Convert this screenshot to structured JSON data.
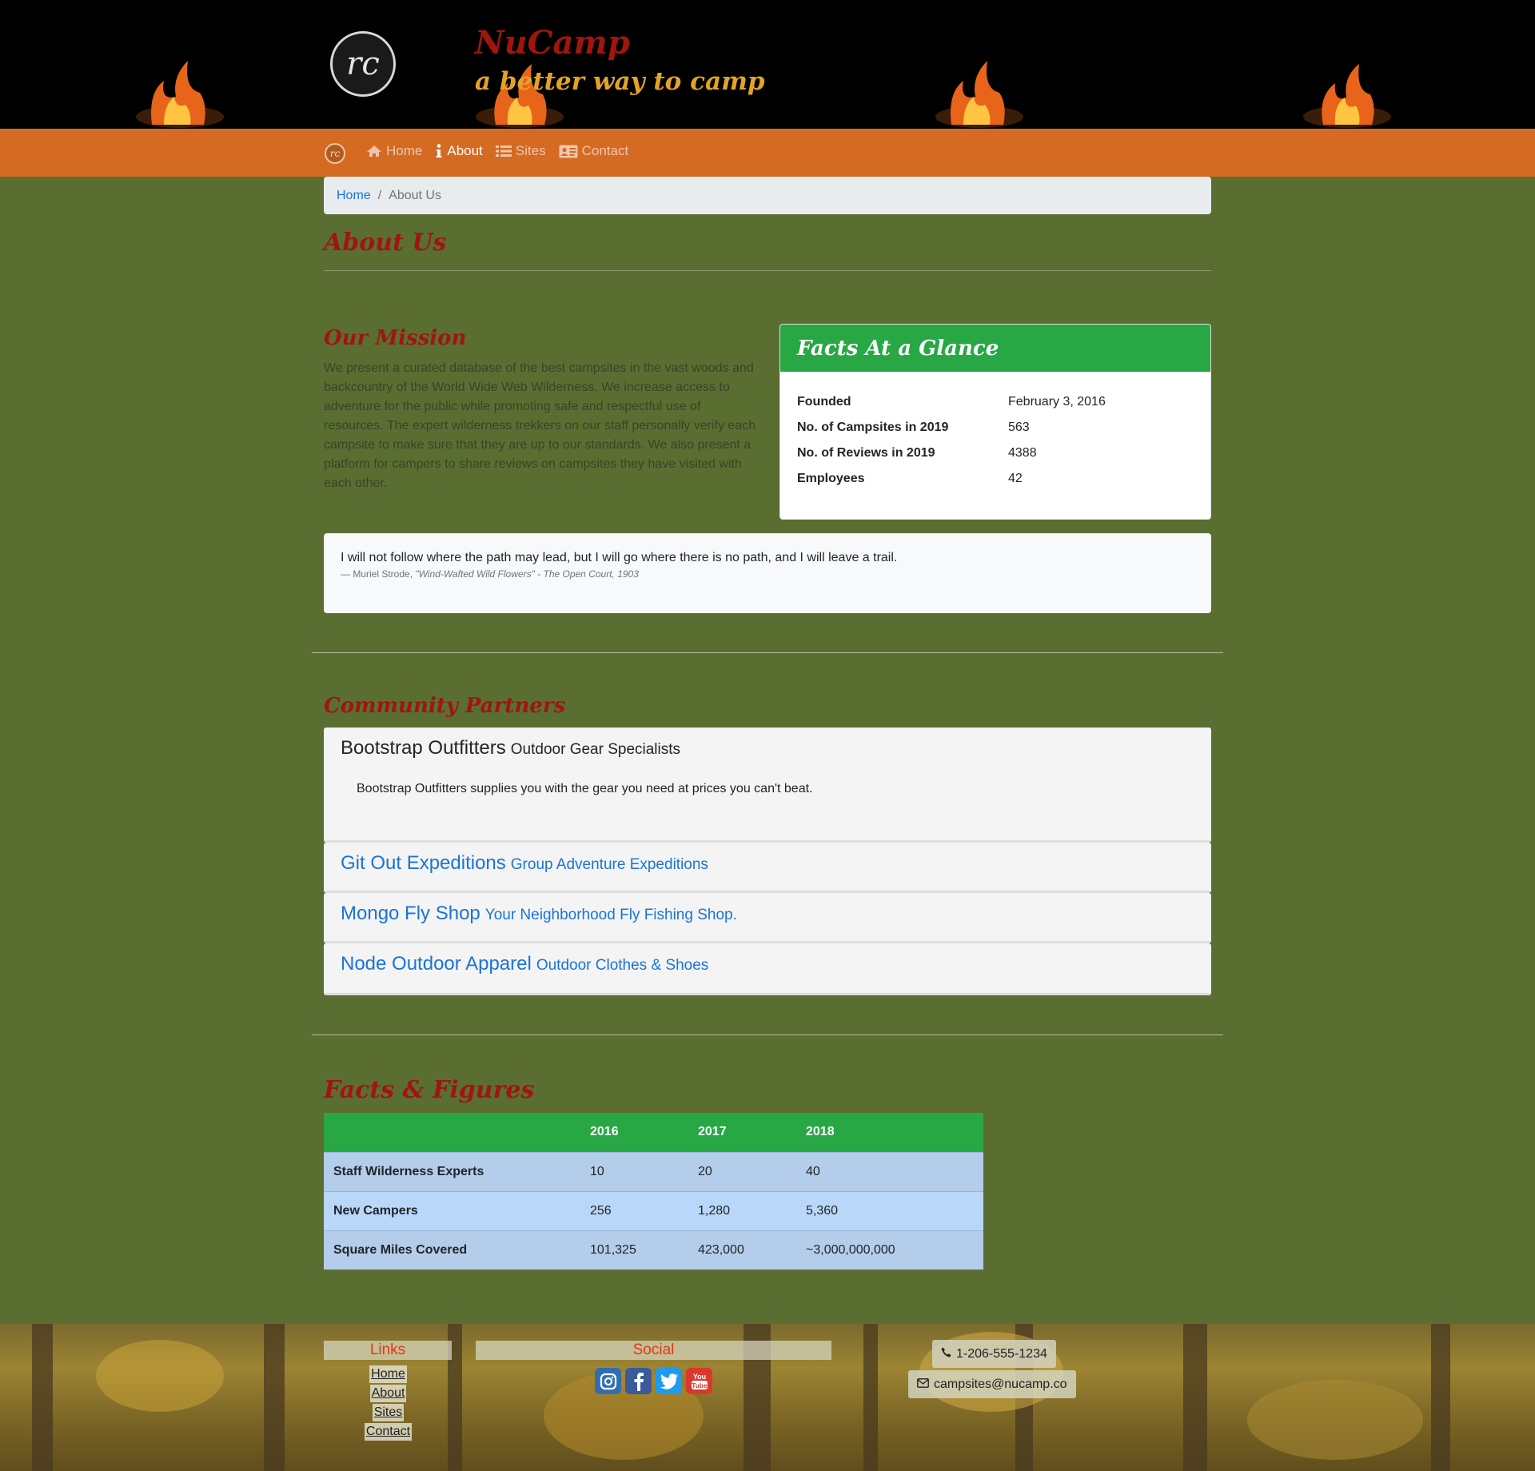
{
  "brand": {
    "title": "NuCamp",
    "tagline": "a better way to camp",
    "logo_glyph": "rc"
  },
  "nav": {
    "items": [
      {
        "label": "Home",
        "icon": "home-icon"
      },
      {
        "label": "About",
        "icon": "info-icon",
        "active": true
      },
      {
        "label": "Sites",
        "icon": "list-icon"
      },
      {
        "label": "Contact",
        "icon": "address-card-icon"
      }
    ]
  },
  "breadcrumb": {
    "home": "Home",
    "separator": "/",
    "current": "About Us"
  },
  "page": {
    "title": "About Us"
  },
  "mission": {
    "heading": "Our Mission",
    "text": "We present a curated database of the best campsites in the vast woods and backcountry of the World Wide Web Wilderness. We increase access to adventure for the public while promoting safe and respectful use of resources. The expert wilderness trekkers on our staff personally verify each campsite to make sure that they are up to our standards. We also present a platform for campers to share reviews on campsites they have visited with each other."
  },
  "facts": {
    "heading": "Facts At a Glance",
    "rows": [
      {
        "label": "Founded",
        "value": "February 3, 2016"
      },
      {
        "label": "No. of Campsites in 2019",
        "value": "563"
      },
      {
        "label": "No. of Reviews in 2019",
        "value": "4388"
      },
      {
        "label": "Employees",
        "value": "42"
      }
    ]
  },
  "quote": {
    "text": "I will not follow where the path may lead, but I will go where there is no path, and I will leave a trail.",
    "author": "— Muriel Strode,",
    "source": "\"Wind-Wafted Wild Flowers\" - The Open Court, 1903"
  },
  "partners": {
    "heading": "Community Partners",
    "items": [
      {
        "name": "Bootstrap Outfitters",
        "subtitle": "Outdoor Gear Specialists",
        "description": "Bootstrap Outfitters supplies you with the gear you need at prices you can't beat."
      },
      {
        "name": "Git Out Expeditions",
        "subtitle": "Group Adventure Expeditions"
      },
      {
        "name": "Mongo Fly Shop",
        "subtitle": "Your Neighborhood Fly Fishing Shop."
      },
      {
        "name": "Node Outdoor Apparel",
        "subtitle": "Outdoor Clothes & Shoes"
      }
    ]
  },
  "figures": {
    "heading": "Facts & Figures",
    "columns": [
      "",
      "2016",
      "2017",
      "2018"
    ],
    "rows": [
      [
        "Staff Wilderness Experts",
        "10",
        "20",
        "40"
      ],
      [
        "New Campers",
        "256",
        "1,280",
        "5,360"
      ],
      [
        "Square Miles Covered",
        "101,325",
        "423,000",
        "~3,000,000,000"
      ]
    ]
  },
  "footer": {
    "links_heading": "Links",
    "links": [
      "Home",
      "About",
      "Sites",
      "Contact"
    ],
    "social_heading": "Social",
    "social": [
      "instagram-icon",
      "facebook-icon",
      "twitter-icon",
      "youtube-icon"
    ],
    "phone": "1-206-555-1234",
    "email": "campsites@nucamp.co"
  },
  "colors": {
    "page_bg": "#5a6e32",
    "navbar": "#d56a22",
    "heading_red": "#a0150f",
    "tagline_gold": "#e3a325",
    "card_green": "#28a745",
    "link_blue": "#1a73d9"
  }
}
